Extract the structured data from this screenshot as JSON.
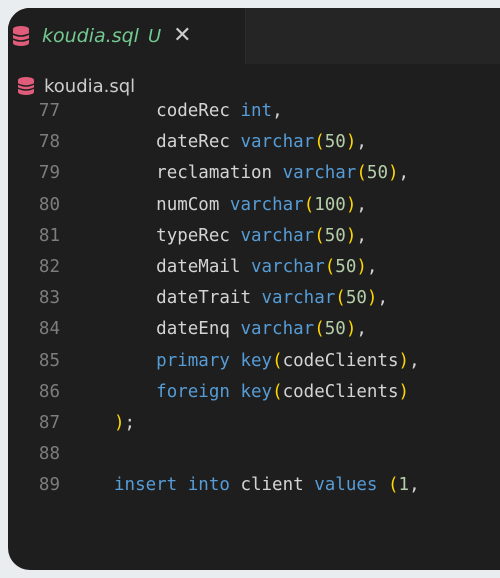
{
  "tab": {
    "title": "koudia.sql",
    "status": "U",
    "close_glyph": "✕",
    "color": "#73c991"
  },
  "breadcrumb": {
    "label": "koudia.sql",
    "icon_color": "#e05c7a"
  },
  "editor": {
    "lines": [
      {
        "number": "77",
        "indent": "    ",
        "tokens": [
          [
            "plain",
            "codeRec "
          ],
          [
            "type",
            "int"
          ],
          [
            "punct",
            ","
          ]
        ]
      },
      {
        "number": "78",
        "indent": "    ",
        "tokens": [
          [
            "plain",
            "dateRec "
          ],
          [
            "type",
            "varchar"
          ],
          [
            "paren",
            "("
          ],
          [
            "num",
            "50"
          ],
          [
            "paren",
            ")"
          ],
          [
            "punct",
            ","
          ]
        ]
      },
      {
        "number": "79",
        "indent": "    ",
        "tokens": [
          [
            "plain",
            "reclamation "
          ],
          [
            "type",
            "varchar"
          ],
          [
            "paren",
            "("
          ],
          [
            "num",
            "50"
          ],
          [
            "paren",
            ")"
          ],
          [
            "punct",
            ","
          ]
        ]
      },
      {
        "number": "80",
        "indent": "    ",
        "tokens": [
          [
            "plain",
            "numCom "
          ],
          [
            "type",
            "varchar"
          ],
          [
            "paren",
            "("
          ],
          [
            "num",
            "100"
          ],
          [
            "paren",
            ")"
          ],
          [
            "punct",
            ","
          ]
        ]
      },
      {
        "number": "81",
        "indent": "    ",
        "tokens": [
          [
            "plain",
            "typeRec "
          ],
          [
            "type",
            "varchar"
          ],
          [
            "paren",
            "("
          ],
          [
            "num",
            "50"
          ],
          [
            "paren",
            ")"
          ],
          [
            "punct",
            ","
          ]
        ]
      },
      {
        "number": "82",
        "indent": "    ",
        "tokens": [
          [
            "plain",
            "dateMail "
          ],
          [
            "type",
            "varchar"
          ],
          [
            "paren",
            "("
          ],
          [
            "num",
            "50"
          ],
          [
            "paren",
            ")"
          ],
          [
            "punct",
            ","
          ]
        ]
      },
      {
        "number": "83",
        "indent": "    ",
        "tokens": [
          [
            "plain",
            "dateTrait "
          ],
          [
            "type",
            "varchar"
          ],
          [
            "paren",
            "("
          ],
          [
            "num",
            "50"
          ],
          [
            "paren",
            ")"
          ],
          [
            "punct",
            ","
          ]
        ]
      },
      {
        "number": "84",
        "indent": "    ",
        "tokens": [
          [
            "plain",
            "dateEnq "
          ],
          [
            "type",
            "varchar"
          ],
          [
            "paren",
            "("
          ],
          [
            "num",
            "50"
          ],
          [
            "paren",
            ")"
          ],
          [
            "punct",
            ","
          ]
        ]
      },
      {
        "number": "85",
        "indent": "    ",
        "tokens": [
          [
            "kw",
            "primary "
          ],
          [
            "kw",
            "key"
          ],
          [
            "paren",
            "("
          ],
          [
            "plain",
            "codeClients"
          ],
          [
            "paren",
            ")"
          ],
          [
            "punct",
            ","
          ]
        ]
      },
      {
        "number": "86",
        "indent": "    ",
        "tokens": [
          [
            "kw",
            "foreign "
          ],
          [
            "kw",
            "key"
          ],
          [
            "paren",
            "("
          ],
          [
            "plain",
            "codeClients"
          ],
          [
            "paren",
            ")"
          ]
        ]
      },
      {
        "number": "87",
        "indent": "",
        "tokens": [
          [
            "paren",
            ")"
          ],
          [
            "punct",
            ";"
          ]
        ]
      },
      {
        "number": "88",
        "indent": "",
        "tokens": []
      },
      {
        "number": "89",
        "indent": "",
        "tokens": [
          [
            "kw",
            "insert "
          ],
          [
            "kw",
            "into "
          ],
          [
            "plain",
            "client "
          ],
          [
            "kw",
            "values "
          ],
          [
            "paren",
            "("
          ],
          [
            "num",
            "1"
          ],
          [
            "punct",
            ","
          ]
        ]
      }
    ]
  }
}
